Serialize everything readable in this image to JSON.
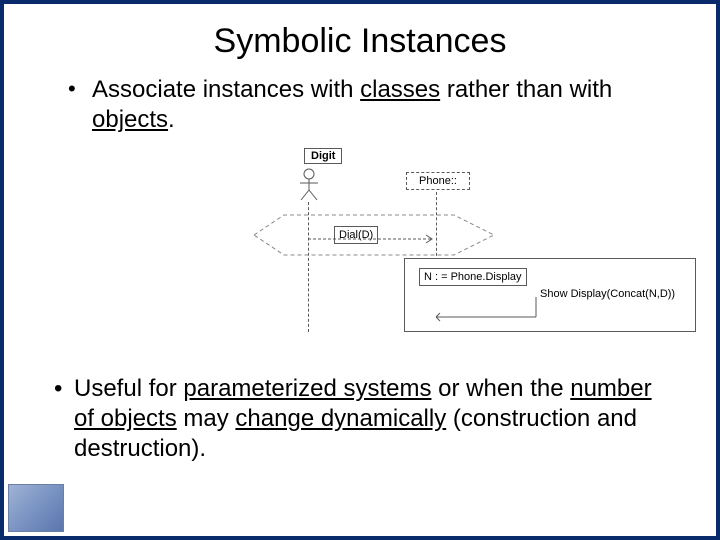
{
  "title": "Symbolic Instances",
  "bullet1": {
    "prefix": "Associate instances with ",
    "em1": "classes",
    "mid": " rather than with ",
    "em2": "objects",
    "suffix": "."
  },
  "bullet2": {
    "prefix": "Useful for ",
    "em1": "parameterized systems",
    "mid1": " or when the ",
    "em2": "number of objects",
    "mid2": " may ",
    "em3": "change dynamically",
    "suffix": " (construction and destruction)."
  },
  "diagram": {
    "digit": "Digit",
    "phone": "Phone::",
    "dial": "Dial(D)",
    "assign": "N : = Phone.Display",
    "show": "Show Display(Concat(N,D))"
  }
}
